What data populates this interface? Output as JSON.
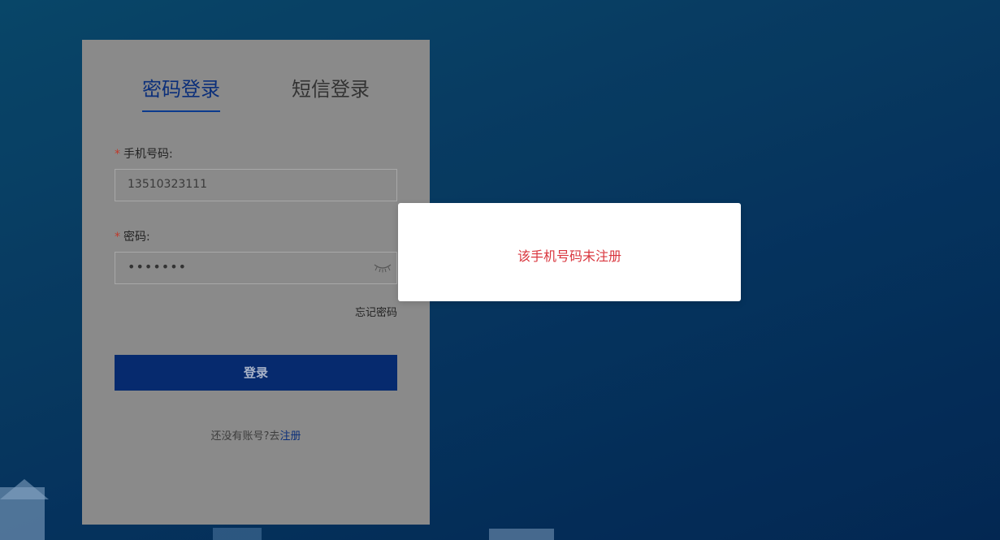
{
  "login": {
    "tabs": [
      {
        "label": "密码登录",
        "active": true
      },
      {
        "label": "短信登录",
        "active": false
      }
    ],
    "phone": {
      "required_mark": "*",
      "label": "手机号码:",
      "value": "13510323111"
    },
    "password": {
      "required_mark": "*",
      "label": "密码:",
      "masked_value": "•••••••",
      "toggle_icon": "eye-closed-icon"
    },
    "forgot_label": "忘记密码",
    "submit_label": "登录",
    "register_prompt": "还没有账号?去",
    "register_link": "注册"
  },
  "toast": {
    "message": "该手机号码未注册"
  },
  "colors": {
    "primary": "#062a6e",
    "error": "#d9363e",
    "overlay_card": "#8a8a8a"
  }
}
